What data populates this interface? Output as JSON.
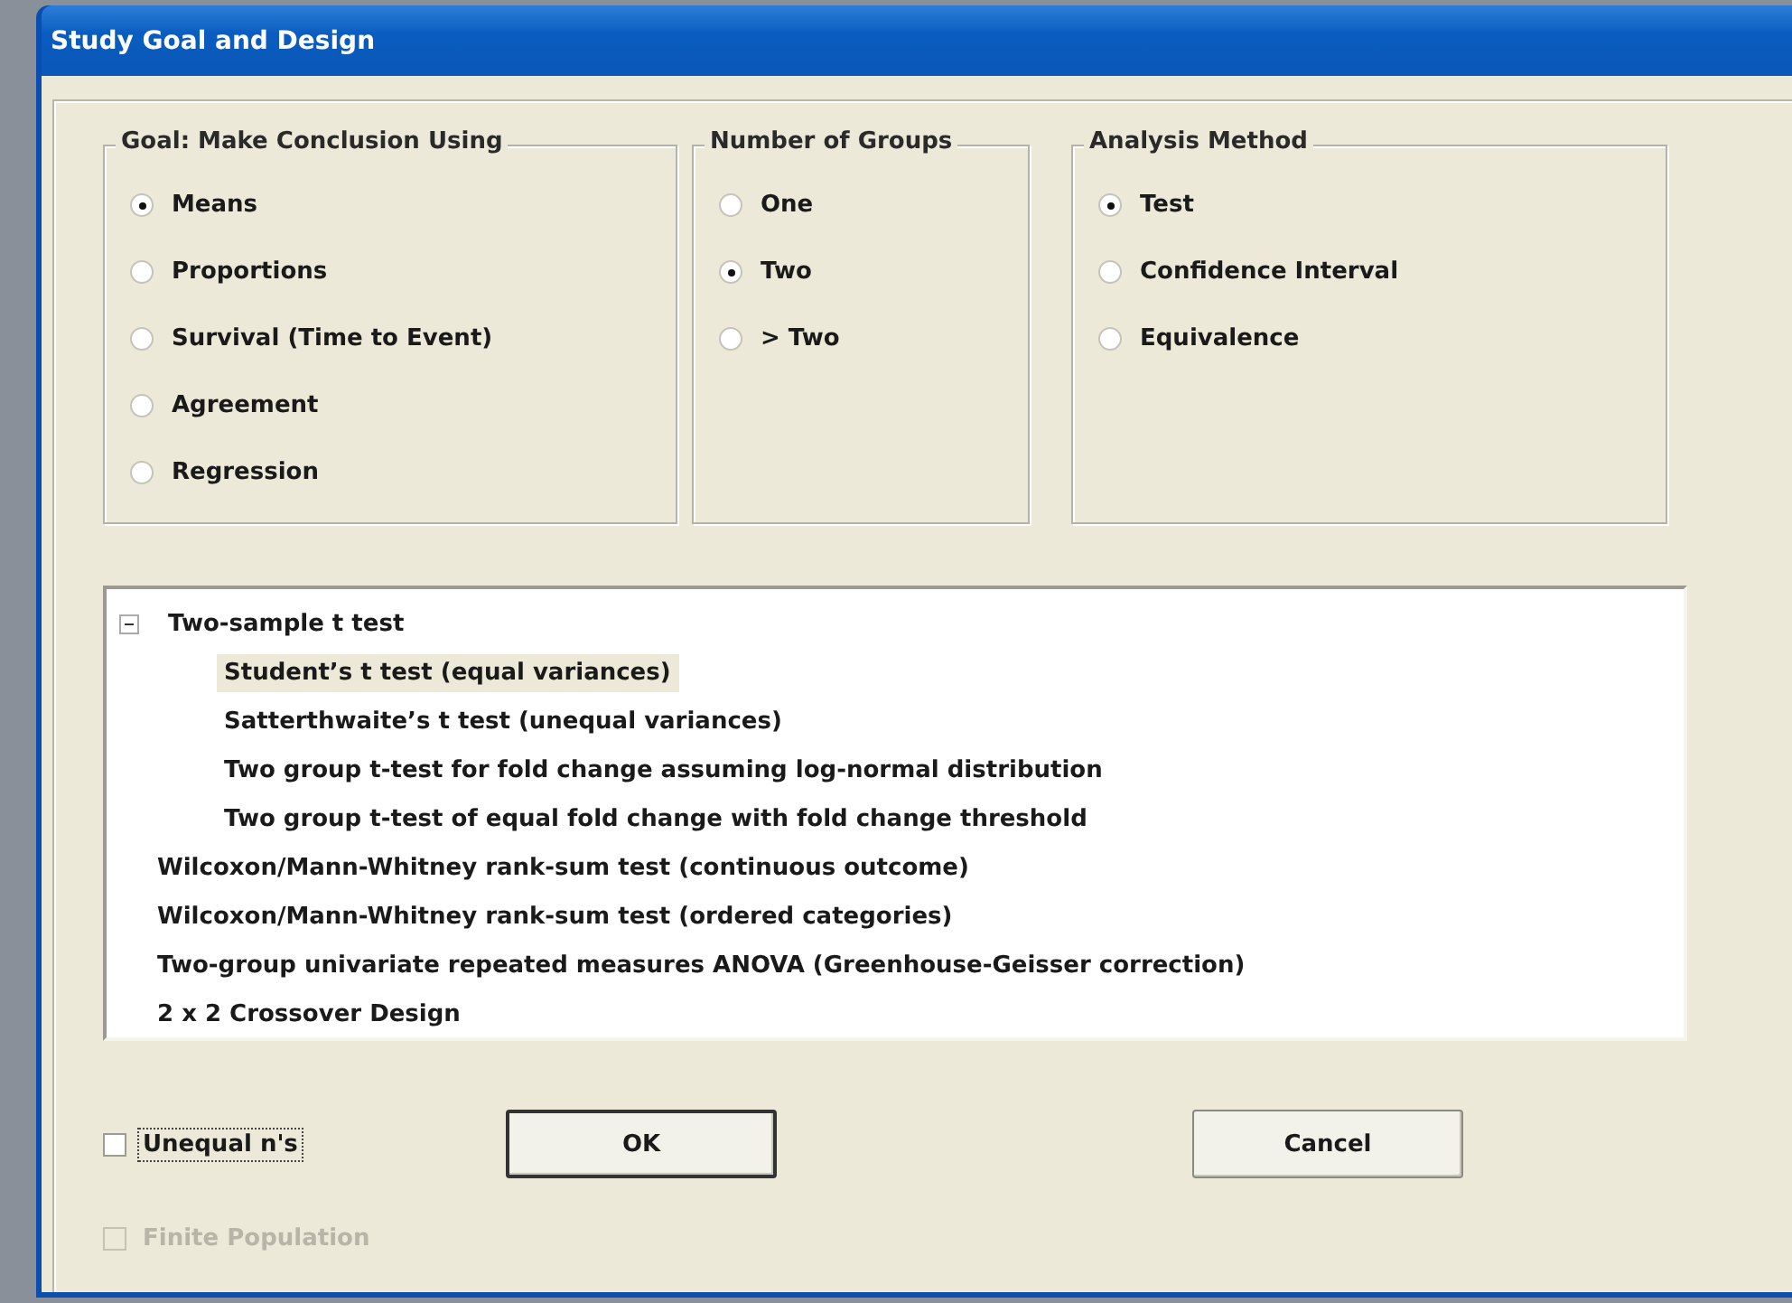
{
  "window": {
    "title": "Study Goal and Design"
  },
  "groups": [
    {
      "title": "Goal: Make Conclusion Using",
      "options": [
        {
          "label": "Means",
          "selected": true
        },
        {
          "label": "Proportions",
          "selected": false
        },
        {
          "label": "Survival (Time to Event)",
          "selected": false
        },
        {
          "label": "Agreement",
          "selected": false
        },
        {
          "label": "Regression",
          "selected": false
        }
      ]
    },
    {
      "title": "Number of Groups",
      "options": [
        {
          "label": "One",
          "selected": false
        },
        {
          "label": "Two",
          "selected": true
        },
        {
          "label": "> Two",
          "selected": false
        }
      ]
    },
    {
      "title": "Analysis Method",
      "options": [
        {
          "label": "Test",
          "selected": true
        },
        {
          "label": "Confidence Interval",
          "selected": false
        },
        {
          "label": "Equivalence",
          "selected": false
        }
      ]
    }
  ],
  "tree": [
    {
      "label": "Two-sample t test",
      "expanded": true,
      "selected": false,
      "children": [
        {
          "label": "Student’s t test (equal variances)",
          "selected": true
        },
        {
          "label": "Satterthwaite’s t test (unequal variances)",
          "selected": false
        },
        {
          "label": "Two group t-test for fold change assuming log-normal distribution",
          "selected": false
        },
        {
          "label": "Two group t-test of equal fold change with fold change threshold",
          "selected": false
        }
      ]
    },
    {
      "label": "Wilcoxon/Mann-Whitney rank-sum test (continuous outcome)",
      "selected": false
    },
    {
      "label": "Wilcoxon/Mann-Whitney rank-sum test (ordered categories)",
      "selected": false
    },
    {
      "label": "Two-group univariate repeated measures ANOVA (Greenhouse-Geisser correction)",
      "selected": false
    },
    {
      "label": "2 x 2 Crossover Design",
      "selected": false
    }
  ],
  "checkboxes": [
    {
      "label": "Unequal n's",
      "checked": false,
      "disabled": false,
      "focused": true
    },
    {
      "label": "Finite Population",
      "checked": false,
      "disabled": true,
      "focused": false
    }
  ],
  "buttons": [
    {
      "label": "OK",
      "default": true
    },
    {
      "label": "Cancel",
      "default": false
    }
  ]
}
